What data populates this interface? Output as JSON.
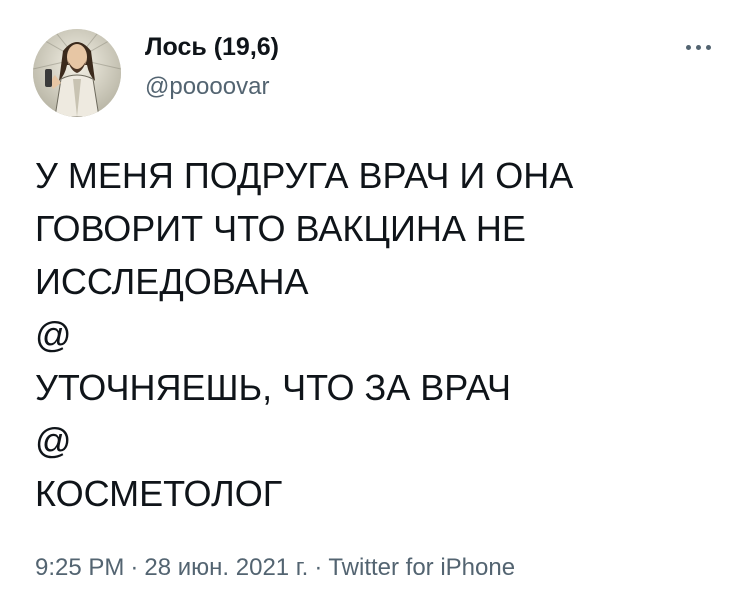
{
  "tweet": {
    "author": {
      "display_name": "Лось (19,6)",
      "handle": "@poooovar",
      "avatar_icon": "profile-photo"
    },
    "more_icon": "more-horizontal-icon",
    "text_lines": [
      "У МЕНЯ ПОДРУГА ВРАЧ И ОНА",
      "ГОВОРИТ ЧТО ВАКЦИНА НЕ",
      "ИССЛЕДОВАНА",
      "@",
      "УТОЧНЯЕШЬ, ЧТО ЗА ВРАЧ",
      "@",
      "КОСМЕТОЛОГ"
    ],
    "meta": {
      "time": "9:25 PM",
      "separator": "·",
      "date": "28 июн. 2021 г.",
      "source": "Twitter for iPhone"
    }
  },
  "colors": {
    "primary_text": "#0f1419",
    "secondary_text": "#536471",
    "background": "#ffffff"
  }
}
